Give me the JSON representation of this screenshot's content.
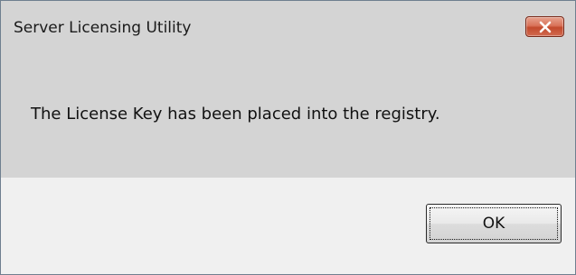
{
  "window": {
    "title": "Server Licensing Utility",
    "close_icon": "close-icon",
    "close_color": "#c24a2d"
  },
  "message": {
    "text": "The License Key has been placed into the registry."
  },
  "buttons": {
    "ok_label": "OK"
  }
}
